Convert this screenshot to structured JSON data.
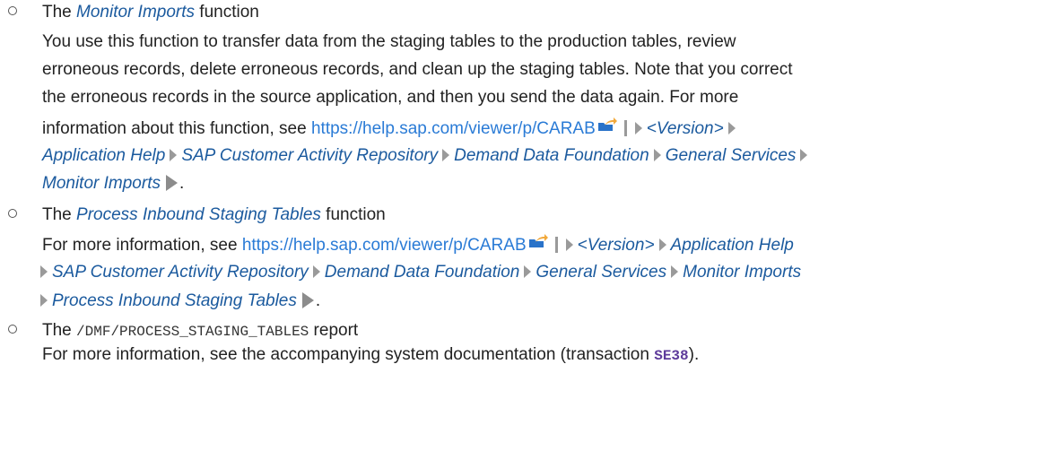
{
  "items": [
    {
      "prefix": "The ",
      "name": "Monitor Imports",
      "suffix": " function",
      "desc_lines": [
        "You use this function to transfer data from the staging tables to the production tables, review",
        "erroneous records, delete erroneous records, and clean up the staging tables. Note that you correct",
        "the erroneous records in the source application, and then you send the data again. For more"
      ],
      "link_intro": "information about this function, see ",
      "url": "https://help.sap.com/viewer/p/CARAB",
      "path": [
        "<Version>",
        "Application Help",
        "SAP Customer Activity Repository",
        "Demand Data Foundation",
        "General Services",
        "Monitor Imports"
      ],
      "end": "."
    },
    {
      "prefix": "The ",
      "name": "Process Inbound Staging Tables",
      "suffix": " function",
      "link_intro": "For more information, see ",
      "url": "https://help.sap.com/viewer/p/CARAB",
      "path": [
        "<Version>",
        "Application Help",
        "SAP Customer Activity Repository",
        "Demand Data Foundation",
        "General Services",
        "Monitor Imports",
        "Process Inbound Staging Tables"
      ],
      "end": "."
    },
    {
      "prefix": "The ",
      "code": "/DMF/PROCESS_STAGING_TABLES",
      "suffix": " report",
      "desc_start": "For more information, see the accompanying system documentation (transaction ",
      "transaction": "SE38",
      "desc_end": ")."
    }
  ],
  "icons": {
    "external_link": "external-link-icon",
    "path_separator": "chevron-right-icon",
    "path_end": "chevron-end-icon"
  },
  "colors": {
    "link": "#2a7bd6",
    "emphasis": "#1b5a9e",
    "transaction": "#5e3b9b",
    "chevron": "#9a9a9a"
  }
}
